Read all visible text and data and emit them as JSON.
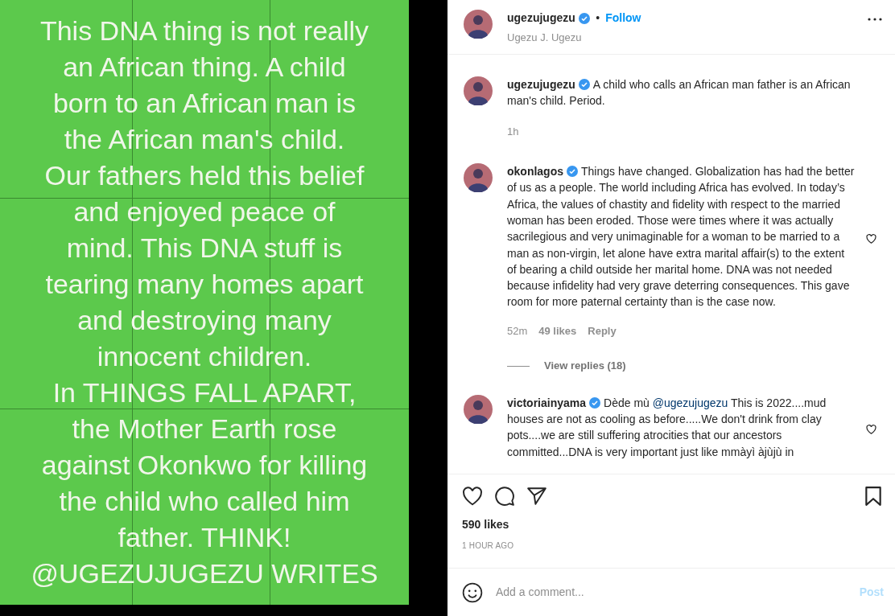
{
  "post_image": {
    "lines": [
      "This DNA thing is not really",
      "an African thing. A child",
      "born to an African man is",
      "the African man's child.",
      "Our fathers held this belief",
      "and enjoyed peace of",
      "mind. This DNA stuff is",
      "tearing many homes apart",
      "and destroying many",
      "innocent children.",
      "In THINGS FALL APART,",
      "the Mother Earth rose",
      "against Okonkwo for killing",
      "the child who called him",
      "father. THINK!",
      "@UGEZUJUGEZU WRITES"
    ]
  },
  "header": {
    "username": "ugezujugezu",
    "verified": true,
    "separator": "•",
    "follow": "Follow",
    "subtitle": "Ugezu J. Ugezu"
  },
  "caption": {
    "username": "ugezujugezu",
    "verified": true,
    "text": "A child who calls an African man father is an African man's child. Period.",
    "time": "1h"
  },
  "comments": [
    {
      "username": "okonlagos",
      "verified": true,
      "parts": [
        {
          "text": "Things have changed. Globalization has had the better of us as a people. The world including Africa has evolved. In today’s Africa, the values of chastity and fidelity with respect to the married woman has been eroded. Those were times where it was actually sacrilegious and very unimaginable for a woman to be married to a man as non-virgin, let alone have extra marital affair(s) to the extent of bearing a child outside her marital home. DNA was not needed because infidelity had very grave deterring consequences. This gave room for more paternal certainty than is the case now."
        }
      ],
      "time": "52m",
      "likes": "49 likes",
      "reply": "Reply",
      "view_replies": "View replies (18)"
    },
    {
      "username": "victoriainyama",
      "verified": true,
      "parts": [
        {
          "text": "Dède mù "
        },
        {
          "text": "@ugezujugezu",
          "kind": "mention"
        },
        {
          "text": " This is 2022....mud houses are not as cooling as before.....We don't drink from clay pots....we are still suffering atrocities that our ancestors committed...DNA is very important just like mmàyì àjùjù in"
        }
      ]
    }
  ],
  "likes": "590 likes",
  "posted": "1 HOUR AGO",
  "comment_box": {
    "placeholder": "Add a comment...",
    "post": "Post",
    "disabled": true
  }
}
